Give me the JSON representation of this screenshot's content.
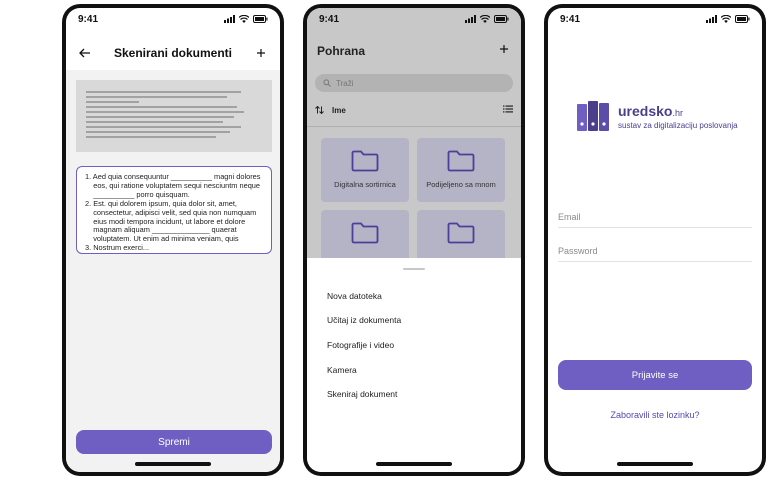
{
  "status": {
    "time": "9:41"
  },
  "scan_screen": {
    "title": "Skenirani dokumenti",
    "ocr_text": "1. Aed quia consequuntur __________ magni dolores\n    eos, qui ratione voluptatem sequi nesciuntm neque\n    __________ porro quisquam.\n2. Est. qui dolorem ipsum, quia dolor sit, amet,\n    consectetur, adipisci velit, sed quia non numquam\n    eius modi tempora incidunt, ut labore et dolore\n    magnam aliquam ______________ quaerat\n    voluptatem. Ut enim ad minima veniam, quis\n3. Nostrum exerci...",
    "save_label": "Spremi"
  },
  "storage_screen": {
    "title": "Pohrana",
    "search_placeholder": "Traži",
    "sort_label": "Ime",
    "folders": [
      {
        "name": "Digitalna sortirnica"
      },
      {
        "name": "Podijeljeno sa mnom"
      },
      {
        "name": ""
      },
      {
        "name": ""
      }
    ],
    "sheet_items": [
      {
        "label": "Nova datoteka"
      },
      {
        "label": "Učitaj iz dokumenta"
      },
      {
        "label": "Fotografije i video"
      },
      {
        "label": "Kamera"
      },
      {
        "label": "Skeniraj dokument"
      }
    ]
  },
  "login_screen": {
    "brand": "uredsko",
    "brand_tld": ".hr",
    "tagline": "sustav za digitalizaciju poslovanja",
    "email_placeholder": "Email",
    "password_placeholder": "Password",
    "login_label": "Prijavite se",
    "forgot_label": "Zaboravili ste lozinku?"
  },
  "colors": {
    "accent": "#6f5fc2",
    "brand": "#4b3f8c",
    "folder_tile": "#b5b3c6"
  }
}
